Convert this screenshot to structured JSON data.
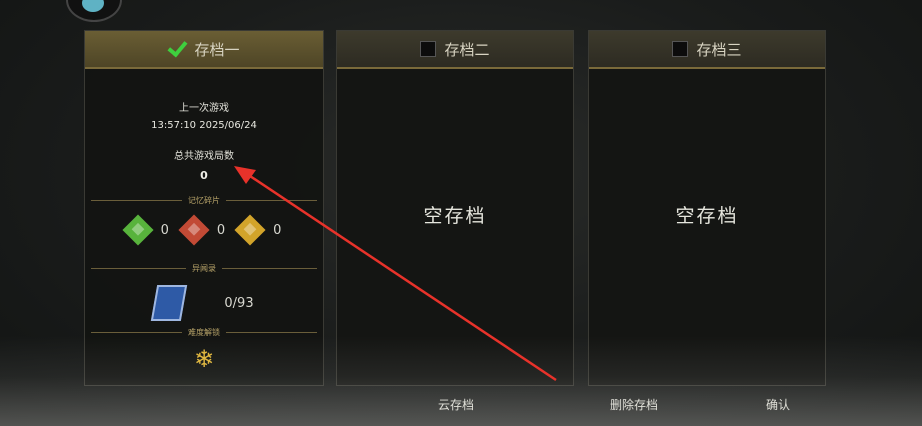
{
  "slots": [
    {
      "title": "存档一",
      "selected": true,
      "last_game_label": "上一次游戏",
      "last_game_time": "13:57:10 2025/06/24",
      "total_games_label": "总共游戏局数",
      "total_games_value": "0",
      "memory_section": "记忆碎片",
      "gems": [
        {
          "icon": "green-gem-icon",
          "count": "0"
        },
        {
          "icon": "red-gem-icon",
          "count": "0"
        },
        {
          "icon": "gold-gem-icon",
          "count": "0"
        }
      ],
      "records_section": "异闻录",
      "records_value": "0/93",
      "difficulty_section": "难度解锁"
    },
    {
      "title": "存档二",
      "selected": false,
      "empty_label": "空存档"
    },
    {
      "title": "存档三",
      "selected": false,
      "empty_label": "空存档"
    }
  ],
  "buttons": {
    "cloud_save": "云存档",
    "delete_save": "删除存档",
    "confirm": "确认"
  },
  "colors": {
    "selected_check": "#3ecf3e",
    "header_gold": "#7a6a3a",
    "annotation_arrow": "#e8322a"
  }
}
